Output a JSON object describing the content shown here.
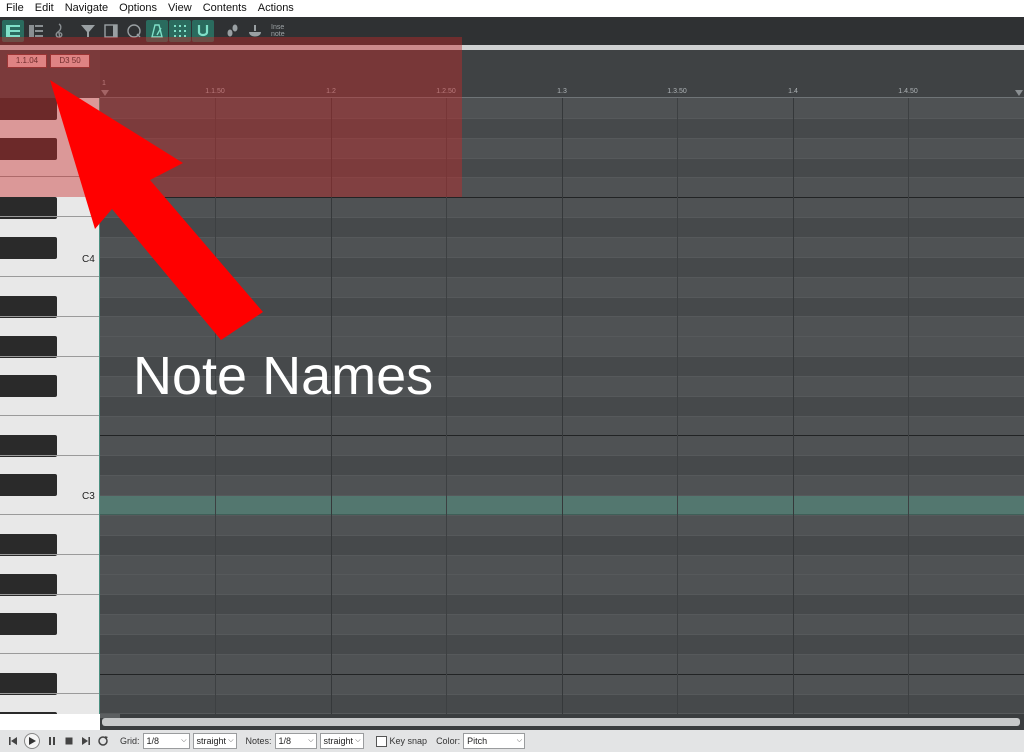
{
  "menu": [
    "File",
    "Edit",
    "Navigate",
    "Options",
    "View",
    "Contents",
    "Actions"
  ],
  "toolbar": {
    "insert_note_label_line1": "Inse",
    "insert_note_label_line2": "note",
    "accent": "#2a6b5e"
  },
  "header": {
    "position_field": "1.1.04",
    "note_field": "D3  50"
  },
  "ruler": {
    "labels": [
      "1",
      "1.1.50",
      "1.2",
      "1.2.50",
      "1.3",
      "1.3.50",
      "1.4",
      "1.4.50"
    ]
  },
  "keyboard": {
    "labels": {
      "c4": "C4",
      "c3": "C3"
    }
  },
  "annotation": {
    "text": "Note Names",
    "color": "#ff0000"
  },
  "bottombar": {
    "grid_label": "Grid:",
    "grid_value": "1/8",
    "grid_mode": "straight",
    "notes_label": "Notes:",
    "notes_value": "1/8",
    "notes_mode": "straight",
    "key_snap_label": "Key snap",
    "color_label": "Color:",
    "color_value": "Pitch"
  }
}
